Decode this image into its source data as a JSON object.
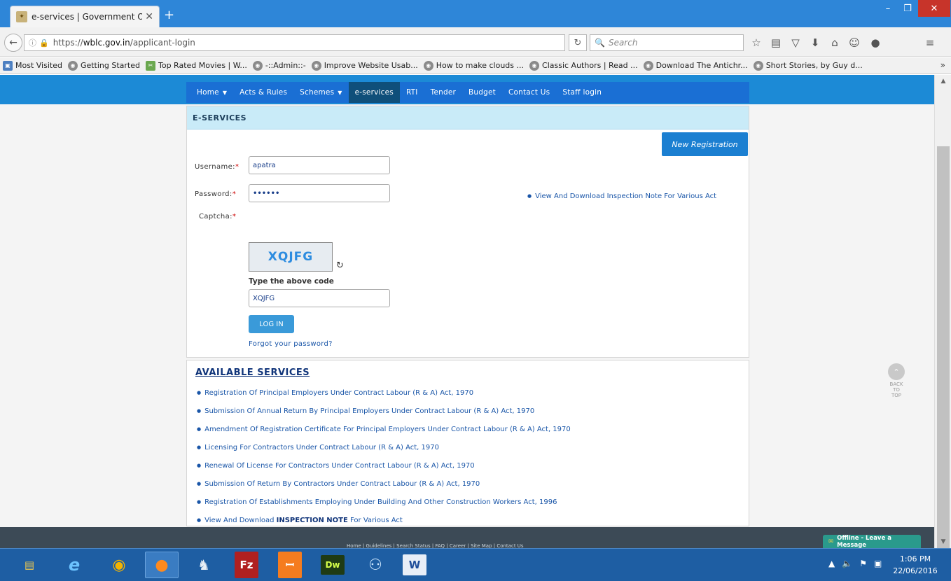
{
  "browser": {
    "tab_title": "e-services | Government O...",
    "url_prefix": "https://",
    "url_host": "wblc.gov.in",
    "url_path": "/applicant-login",
    "search_placeholder": "Search",
    "bookmarks": [
      "Most Visited",
      "Getting Started",
      "Top Rated Movies | W...",
      "-::Admin::-",
      "Improve Website Usab...",
      "How to make clouds ...",
      "Classic Authors | Read ...",
      "Download The Antichr...",
      "Short Stories, by Guy d..."
    ]
  },
  "site": {
    "menu": [
      {
        "label": "Home",
        "caret": true
      },
      {
        "label": "Acts & Rules",
        "caret": false
      },
      {
        "label": "Schemes",
        "caret": true
      },
      {
        "label": "e-services",
        "caret": false
      },
      {
        "label": "RTI",
        "caret": false
      },
      {
        "label": "Tender",
        "caret": false
      },
      {
        "label": "Budget",
        "caret": false
      },
      {
        "label": "Contact Us",
        "caret": false
      },
      {
        "label": "Staff login",
        "caret": false
      }
    ],
    "active_menu": "e-services"
  },
  "login": {
    "heading": "E-SERVICES",
    "new_registration": "New Registration",
    "username_label": "Username:",
    "username_value": "apatra",
    "password_label": "Password:",
    "password_value": "••••••",
    "captcha_label": "Captcha:",
    "captcha_text": "XQJFG",
    "type_code_label": "Type the above code",
    "captcha_input_value": "XQJFG",
    "login_button": "LOG IN",
    "forgot_password": "Forgot your password?",
    "inspection_link": "View And Download Inspection Note For Various Act"
  },
  "services": {
    "title": "AVAILABLE SERVICES",
    "items": [
      "Registration Of Principal Employers Under Contract Labour (R & A) Act, 1970",
      "Submission Of Annual Return By Principal Employers Under Contract Labour (R & A) Act, 1970",
      "Amendment Of Registration Certificate For Principal Employers Under Contract Labour (R & A) Act, 1970",
      "Licensing For Contractors Under Contract Labour (R & A) Act, 1970",
      "Renewal Of License For Contractors Under Contract Labour (R & A) Act, 1970",
      "Submission Of Return By Contractors Under Contract Labour (R & A) Act, 1970",
      "Registration Of Establishments Employing Under Building And Other Construction Workers Act, 1996"
    ],
    "last_item_prefix": "View And Download",
    "last_item_bold": "INSPECTION NOTE",
    "last_item_suffix": "For Various Act"
  },
  "back_to_top": "BACK TO TOP",
  "footer": {
    "links": "Home | Guidelines | Search Status | FAQ | Career | Site Map | Contact Us",
    "offline_chat": "Offline - Leave a Message"
  },
  "taskbar": {
    "time": "1:06 PM",
    "date": "22/06/2016",
    "apps": [
      "file-explorer",
      "internet-explorer",
      "chrome",
      "firefox",
      "pgadmin",
      "filezilla",
      "xampp",
      "dreamweaver",
      "network-app",
      "word"
    ]
  }
}
